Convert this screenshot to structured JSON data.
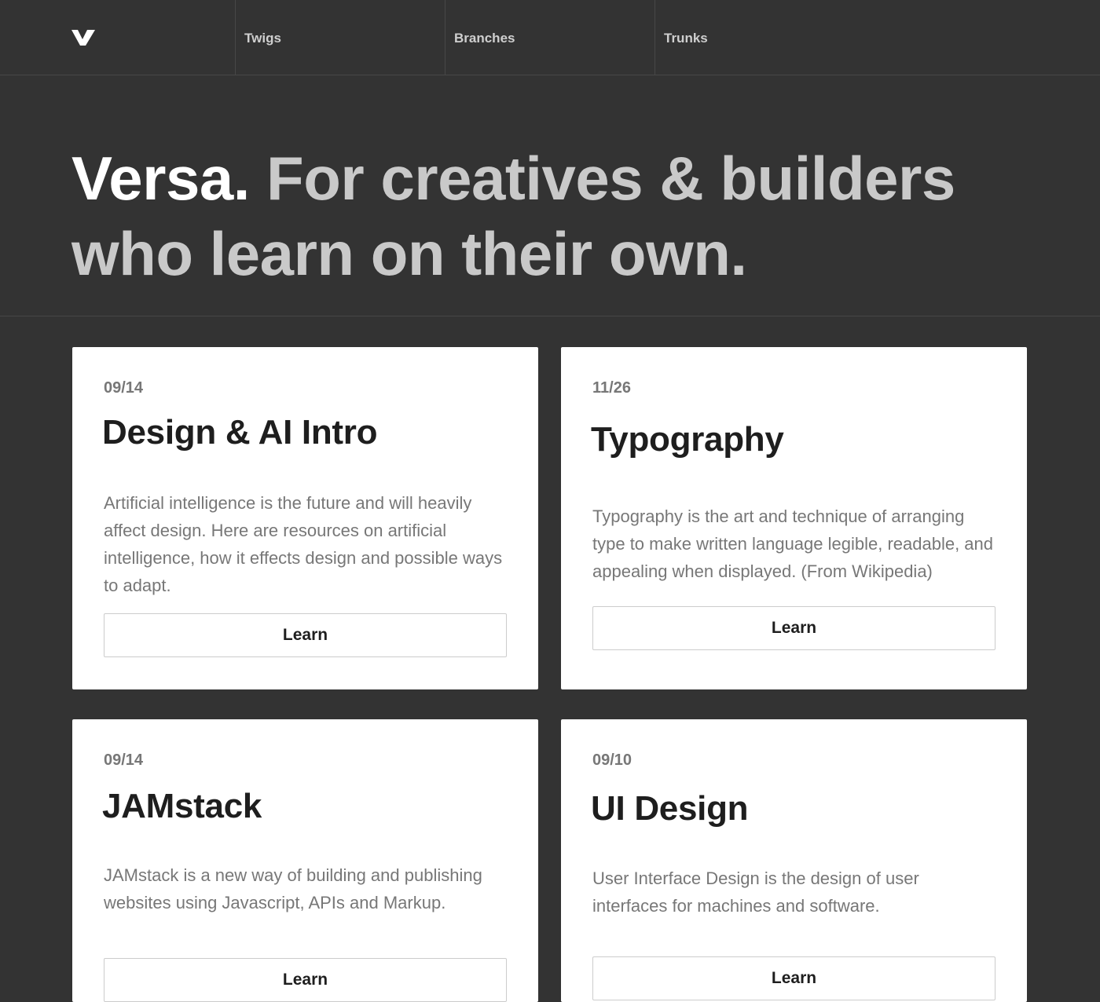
{
  "nav": {
    "logo": "V",
    "items": [
      {
        "label": "Twigs"
      },
      {
        "label": "Branches"
      },
      {
        "label": "Trunks"
      }
    ]
  },
  "hero": {
    "brand": "Versa.",
    "tagline": " For creatives & builders who learn on their own."
  },
  "cards": [
    {
      "date": "09/14",
      "title": "Design & AI Intro",
      "description": "Artificial intelligence is the future and will heavily affect design. Here are resources on artificial intelligence, how it effects design and possible ways to adapt.",
      "button_label": "Learn"
    },
    {
      "date": "11/26",
      "title": "Typography",
      "description": "Typography is the art and technique of arranging type to make written language legible, readable, and appealing when displayed. (From Wikipedia)",
      "button_label": "Learn"
    },
    {
      "date": "09/14",
      "title": "JAMstack",
      "description": "JAMstack is a new way of building and publishing websites using Javascript, APIs and Markup.",
      "button_label": "Learn"
    },
    {
      "date": "09/10",
      "title": "UI Design",
      "description": "User Interface Design is the design of user interfaces for machines and software.",
      "button_label": "Learn"
    }
  ],
  "colors": {
    "background": "#333333",
    "hero_brand": "#ffffff",
    "hero_text": "#c9c9c9",
    "card_background": "#ffffff",
    "card_title": "#1e1e1e",
    "card_meta": "#777777"
  }
}
